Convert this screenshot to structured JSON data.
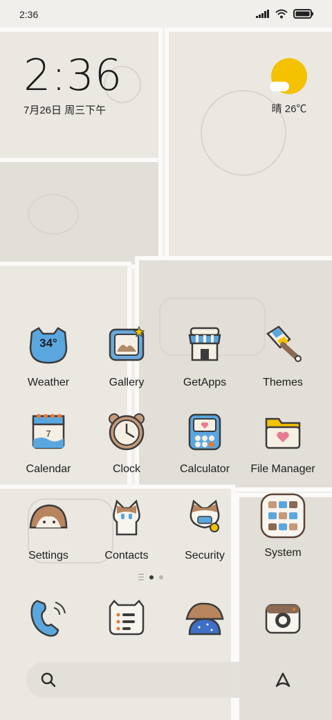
{
  "status_bar": {
    "time": "2:36"
  },
  "clock_widget": {
    "time": "2:36",
    "date": "7月26日 周三下午"
  },
  "weather_widget": {
    "text": "晴 26℃"
  },
  "apps": [
    {
      "label": "Weather",
      "icon": "weather-cat-icon",
      "badge": "34°"
    },
    {
      "label": "Gallery",
      "icon": "gallery-frame-icon"
    },
    {
      "label": "GetApps",
      "icon": "shop-icon"
    },
    {
      "label": "Themes",
      "icon": "paintbrush-icon"
    },
    {
      "label": "Calendar",
      "icon": "calendar-icon",
      "badge": "7"
    },
    {
      "label": "Clock",
      "icon": "alarm-clock-icon"
    },
    {
      "label": "Calculator",
      "icon": "calculator-icon"
    },
    {
      "label": "File Manager",
      "icon": "folder-icon"
    },
    {
      "label": "Settings",
      "icon": "hamster-icon"
    },
    {
      "label": "Contacts",
      "icon": "cat-contacts-icon"
    },
    {
      "label": "Security",
      "icon": "cat-security-icon"
    },
    {
      "label": "System",
      "icon": "system-folder-icon"
    }
  ],
  "dock": [
    {
      "icon": "phone-icon"
    },
    {
      "icon": "messages-icon"
    },
    {
      "icon": "browser-icon"
    },
    {
      "icon": "camera-icon"
    }
  ],
  "page_indicator": {
    "pages": 2,
    "current": 1
  },
  "search_bar": {
    "left_icon": "search-icon",
    "right_icon": "assistant-icon"
  },
  "colors": {
    "accent_blue": "#5aa7e0",
    "sun_yellow": "#f4c200",
    "outline": "#5b4436"
  }
}
